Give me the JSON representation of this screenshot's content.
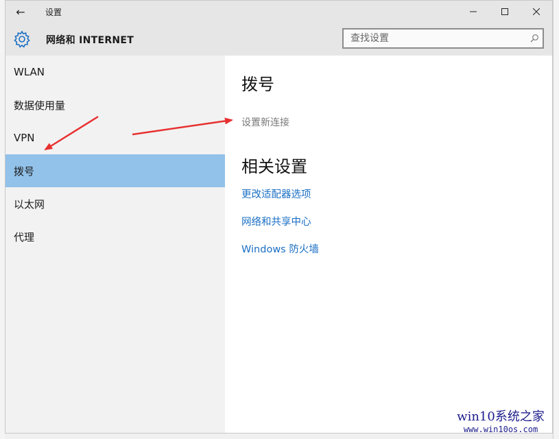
{
  "window": {
    "title": "设置",
    "back_symbol": "←",
    "controls": {
      "minimize": "—",
      "maximize": "☐",
      "close": "✕"
    }
  },
  "header": {
    "icon": "gear-icon",
    "title": "网络和 INTERNET",
    "search": {
      "placeholder": "查找设置",
      "icon": "search-icon"
    }
  },
  "sidebar": {
    "items": [
      {
        "label": "WLAN"
      },
      {
        "label": "数据使用量"
      },
      {
        "label": "VPN"
      },
      {
        "label": "拨号",
        "selected": true
      },
      {
        "label": "以太网"
      },
      {
        "label": "代理"
      }
    ]
  },
  "content": {
    "heading": "拨号",
    "setup_link": "设置新连接",
    "related_heading": "相关设置",
    "related_links": [
      "更改适配器选项",
      "网络和共享中心",
      "Windows 防火墙"
    ]
  },
  "watermark": {
    "line1": "win10系统之家",
    "line2": "www.win10os.com"
  },
  "colors": {
    "selected_item": "#92c1e9",
    "link": "#1a6fc4",
    "annotation_arrow": "#e83030"
  }
}
